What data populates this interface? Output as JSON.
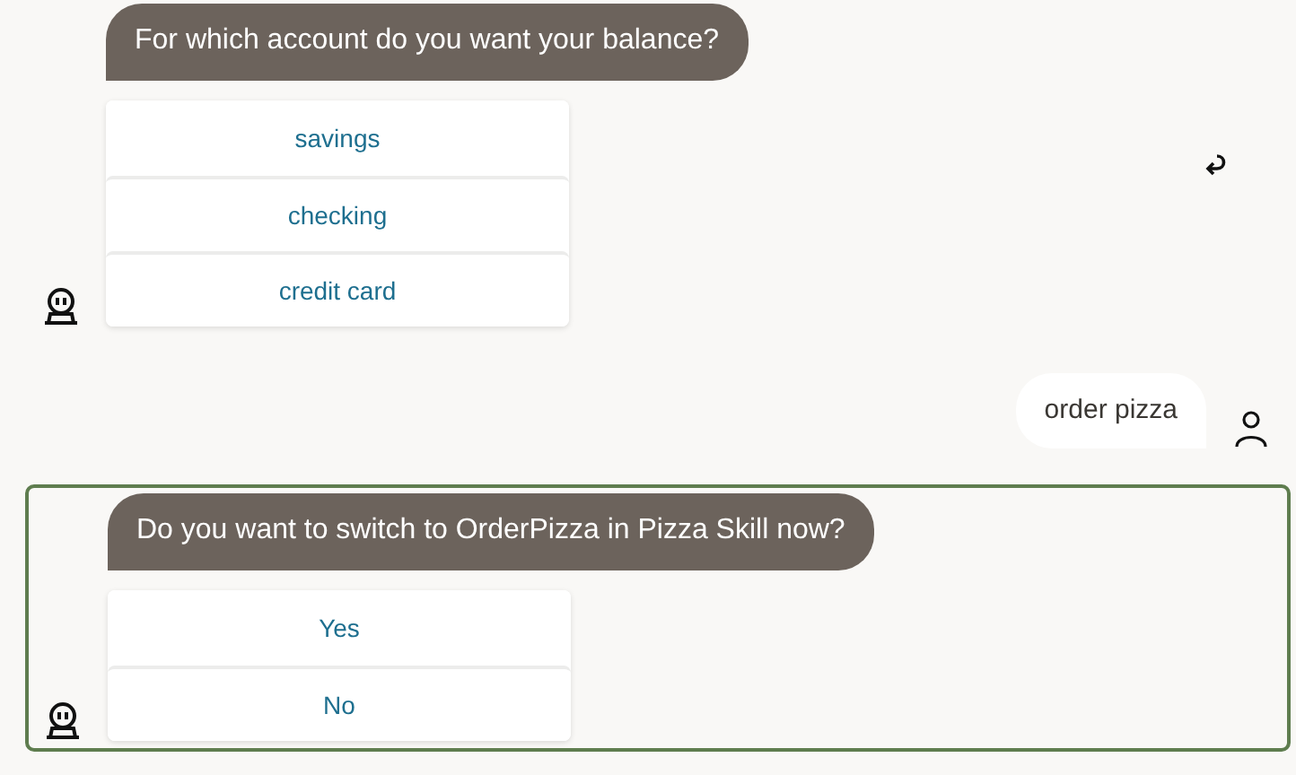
{
  "messages": [
    {
      "kind": "bot",
      "highlighted": false,
      "text": "For which account do you want your balance?",
      "options": [
        "savings",
        "checking",
        "credit card"
      ],
      "undo": true
    },
    {
      "kind": "user",
      "text": "order pizza"
    },
    {
      "kind": "bot",
      "highlighted": true,
      "text": "Do you want to switch to OrderPizza in Pizza Skill now?",
      "options": [
        "Yes",
        "No"
      ],
      "undo": false
    }
  ]
}
